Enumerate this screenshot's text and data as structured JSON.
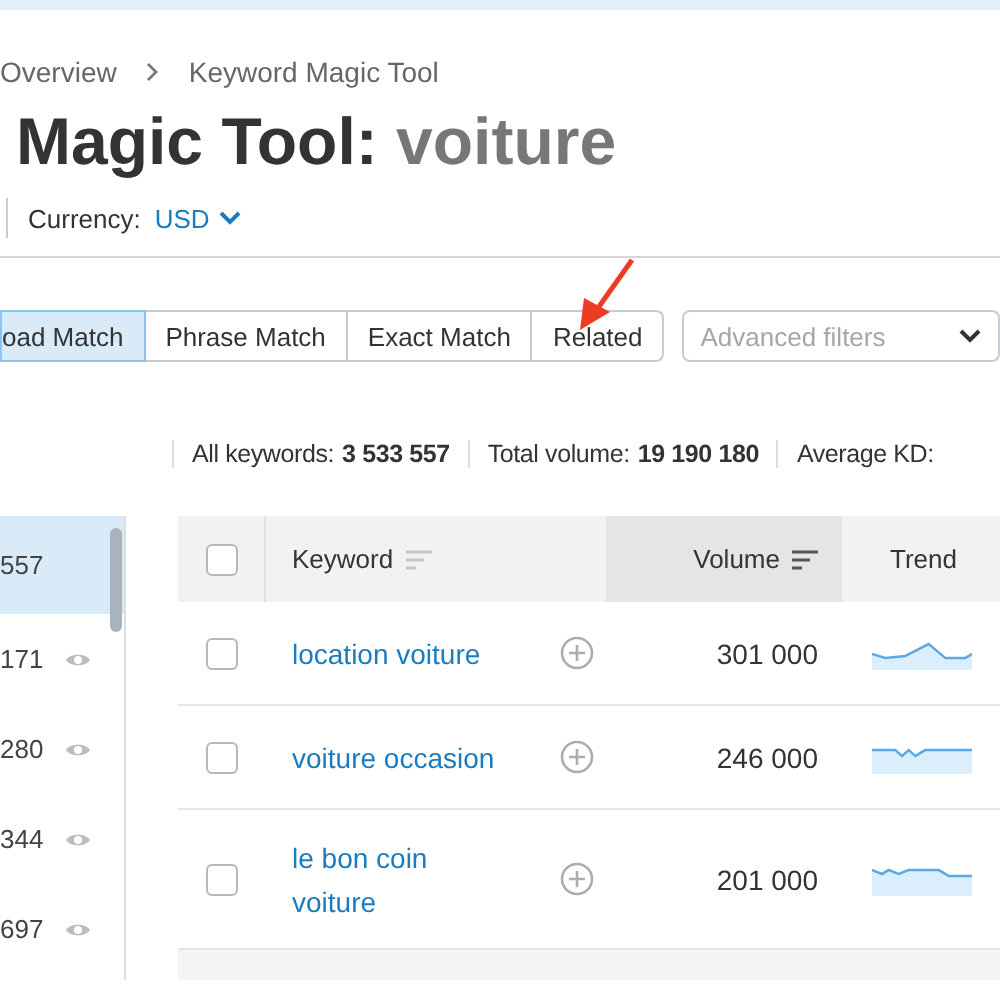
{
  "breadcrumb": [
    "Overview",
    "Keyword Magic Tool"
  ],
  "title": {
    "text": "Magic Tool:",
    "query": "voiture"
  },
  "currency": {
    "label": "Currency:",
    "value": "USD"
  },
  "match_tabs": [
    {
      "label": "oad Match",
      "selected": true
    },
    {
      "label": "Phrase Match",
      "selected": false
    },
    {
      "label": "Exact Match",
      "selected": false
    },
    {
      "label": "Related",
      "selected": false
    }
  ],
  "filters": {
    "placeholder": "Advanced filters"
  },
  "stats": [
    {
      "label": "All keywords:",
      "value": "3 533 557"
    },
    {
      "label": "Total volume:",
      "value": "19 190 180"
    },
    {
      "label": "Average KD:"
    }
  ],
  "sidebar": [
    {
      "count": "557",
      "selected": true,
      "eye": false
    },
    {
      "count": "171",
      "selected": false,
      "eye": true
    },
    {
      "count": "280",
      "selected": false,
      "eye": true
    },
    {
      "count": "344",
      "selected": false,
      "eye": true
    },
    {
      "count": "697",
      "selected": false,
      "eye": true
    }
  ],
  "table": {
    "all_checked": false,
    "columns": [
      {
        "label": "Keyword",
        "sorted": false
      },
      {
        "label": "Volume",
        "sorted": true
      },
      {
        "label": "Trend",
        "sorted": false
      }
    ],
    "rows": [
      {
        "keyword": "location voiture",
        "volume": "301 000",
        "checked": false
      },
      {
        "keyword": "voiture occasion",
        "volume": "246 000",
        "checked": false
      },
      {
        "keyword": "le bon coin voiture",
        "volume": "201 000",
        "checked": false
      }
    ]
  }
}
